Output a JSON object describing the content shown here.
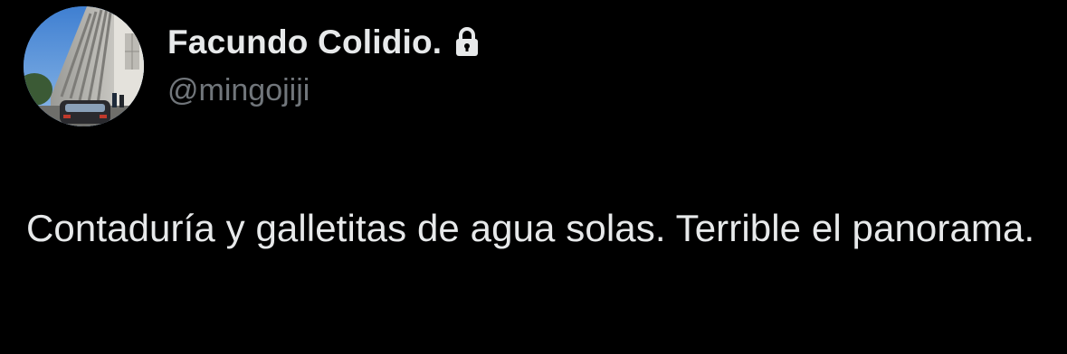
{
  "author": {
    "display_name": "Facundo Colidio.",
    "handle": "@mingojiji",
    "protected": true,
    "protected_icon": "lock-icon",
    "avatar": "building-photo-avatar"
  },
  "tweet": {
    "text": "Contaduría y galletitas de agua solas. Terrible el panorama."
  },
  "colors": {
    "background": "#000000",
    "primary_text": "#e7e9ea",
    "secondary_text": "#71767b"
  }
}
